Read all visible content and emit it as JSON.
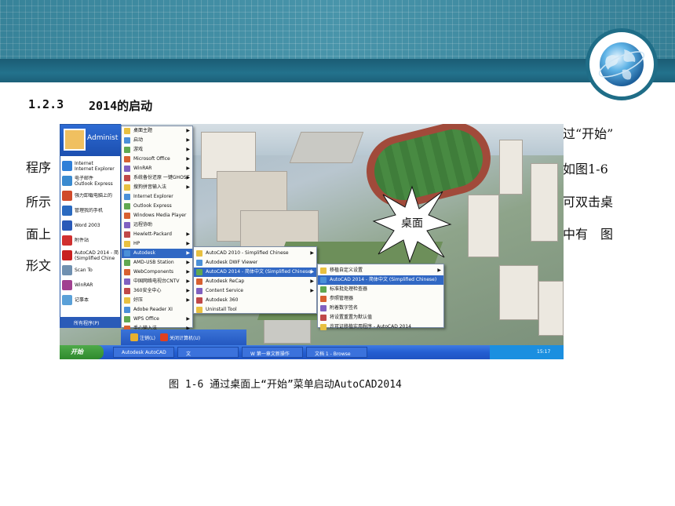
{
  "section": {
    "number": "1.2.3",
    "title": "2014的启动"
  },
  "ghost_text": {
    "left": [
      "程序",
      "所示",
      "面上",
      "形文"
    ],
    "right": [
      "过“开始”",
      "如图1-6",
      "可双击桌",
      "中有　图"
    ]
  },
  "burst_label": "桌面",
  "start_menu": {
    "user_name": "Administ",
    "left_items": [
      {
        "label": "Internet\nInternet Explorer",
        "color": "#2f7fd8"
      },
      {
        "label": "电子邮件\nOutlook Express",
        "color": "#3a8ad0"
      },
      {
        "label": "强力卸载电脑上的",
        "color": "#d04a2a"
      },
      {
        "label": "管理我的手机",
        "color": "#2a6ac0"
      },
      {
        "label": "Word 2003",
        "color": "#2a5ab8"
      },
      {
        "label": "附件站",
        "color": "#d03030"
      },
      {
        "label": "AutoCAD 2014 - 简\n(Simplified Chine",
        "color": "#c82020"
      },
      {
        "label": "Scan To",
        "color": "#7090b0"
      },
      {
        "label": "WinRAR",
        "color": "#a04090"
      },
      {
        "label": "记事本",
        "color": "#5aa0d8"
      }
    ],
    "all_programs": "所有程序(P)",
    "logoff": "注销(L)",
    "shutdown": "关闭计算机(U)"
  },
  "submenu_programs": [
    {
      "label": "桌面主题",
      "arrow": true
    },
    {
      "label": "启动",
      "arrow": true
    },
    {
      "label": "游戏",
      "arrow": true
    },
    {
      "label": "Microsoft Office",
      "arrow": true
    },
    {
      "label": "WinRAR",
      "arrow": true
    },
    {
      "label": "系统备份还原 一键GHOST",
      "arrow": true
    },
    {
      "label": "搜狗拼音输入法",
      "arrow": true
    },
    {
      "label": "Internet Explorer",
      "arrow": false
    },
    {
      "label": "Outlook Express",
      "arrow": false
    },
    {
      "label": "Windows Media Player",
      "arrow": false
    },
    {
      "label": "远程协助",
      "arrow": false
    },
    {
      "label": "Hewlett-Packard",
      "arrow": true
    },
    {
      "label": "HP",
      "arrow": true
    },
    {
      "label": "Autodesk",
      "arrow": true,
      "selected": true
    },
    {
      "label": "AMD-USB Station",
      "arrow": true
    },
    {
      "label": "WebComponents",
      "arrow": true
    },
    {
      "label": "中国网络电视台CNTV",
      "arrow": true
    },
    {
      "label": "360安全中心",
      "arrow": true
    },
    {
      "label": "好压",
      "arrow": true
    },
    {
      "label": "Adobe Reader XI",
      "arrow": false
    },
    {
      "label": "WPS Office",
      "arrow": true
    },
    {
      "label": "手心输入法",
      "arrow": true
    }
  ],
  "submenu_autodesk": [
    {
      "label": "AutoCAD 2010 - Simplified Chinese",
      "arrow": true
    },
    {
      "label": "Autodesk DWF Viewer",
      "arrow": false
    },
    {
      "label": "AutoCAD 2014 - 简体中文 (Simplified Chinese)",
      "arrow": true,
      "selected": true
    },
    {
      "label": "Autodesk ReCap",
      "arrow": true
    },
    {
      "label": "Content Service",
      "arrow": true
    },
    {
      "label": "Autodesk 360",
      "arrow": false
    },
    {
      "label": "Uninstall Tool",
      "arrow": false
    }
  ],
  "submenu_autocad": [
    {
      "label": "移植自定义设置",
      "arrow": true
    },
    {
      "label": "AutoCAD 2014 - 简体中文 (Simplified Chinese)",
      "arrow": false,
      "selected": true
    },
    {
      "label": "标准批处理检查器",
      "arrow": false
    },
    {
      "label": "参照管理器",
      "arrow": false
    },
    {
      "label": "附着数字签名",
      "arrow": false
    },
    {
      "label": "将设置重置为默认值",
      "arrow": false
    },
    {
      "label": "许可证移植实用程序 - AutoCAD 2014",
      "arrow": false
    }
  ],
  "taskbar": {
    "start": "开始",
    "buttons": [
      "Autodesk AutoCAD",
      "文",
      "W 第一章文新操作",
      "文档 1 - Browse"
    ],
    "clock": "15:17"
  },
  "caption": "图 1-6 通过桌面上“开始”菜单启动AutoCAD2014",
  "colors": {
    "header": "#3f8fa6",
    "header_bar": "#1f6d87",
    "xp_blue": "#245ed2",
    "start_green": "#2f8a2d"
  }
}
